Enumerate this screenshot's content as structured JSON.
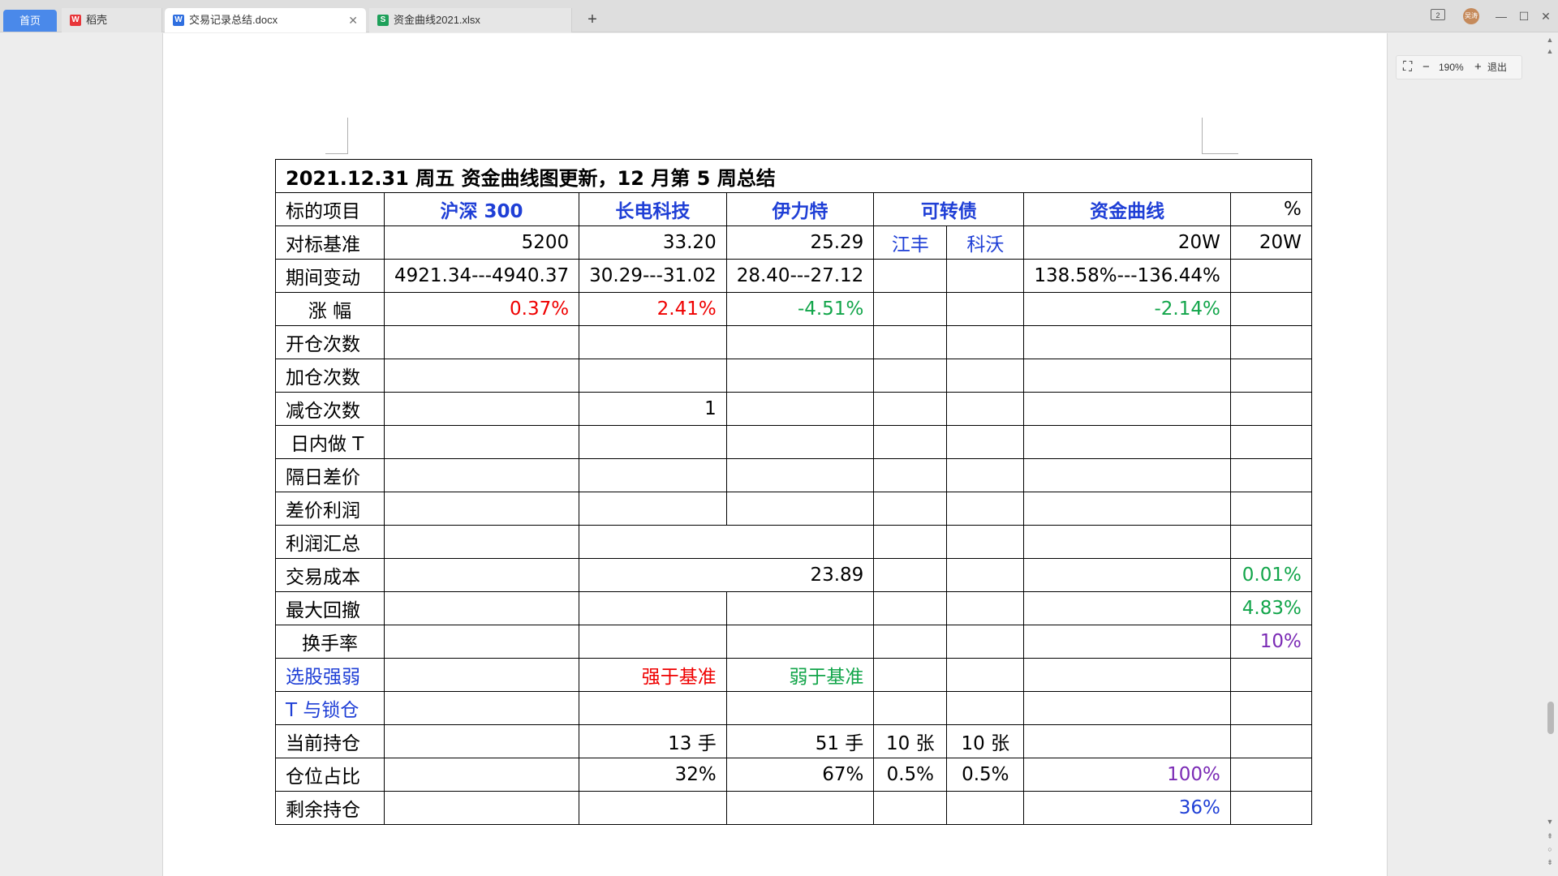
{
  "tabs": {
    "home": "首页",
    "wps": "稻壳",
    "doc": "交易记录总结.docx",
    "xlsx": "资金曲线2021.xlsx"
  },
  "window": {
    "avatar": "吴涛",
    "panel": "2"
  },
  "zoom": {
    "level": "190%",
    "exit": "退出"
  },
  "table": {
    "title": "2021.12.31  周五  资金曲线图更新，12 月第 5 周总结",
    "header": [
      "标的项目",
      "沪深 300",
      "长电科技",
      "伊力特",
      "可转债",
      "资金曲线",
      "%"
    ],
    "rows": {
      "benchmark": {
        "label": "对标基准",
        "hs300": "5200",
        "cd": "33.20",
        "ylt": "25.29",
        "jf": "江丰",
        "kw": "科沃",
        "zj": "20W",
        "pct": "20W"
      },
      "change": {
        "label": "期间变动",
        "hs300": "4921.34---4940.37",
        "cd": "30.29---31.02",
        "ylt": "28.40---27.12",
        "zj": "138.58%---136.44%"
      },
      "rise": {
        "label": "涨  幅",
        "hs300": "0.37%",
        "cd": "2.41%",
        "ylt": "-4.51%",
        "zj": "-2.14%"
      },
      "open": {
        "label": "开仓次数"
      },
      "add": {
        "label": "加仓次数"
      },
      "reduce": {
        "label": "减仓次数",
        "cd": "1"
      },
      "intraday": {
        "label": "日内做 T"
      },
      "overnight": {
        "label": "隔日差价"
      },
      "profit": {
        "label": "差价利润"
      },
      "total": {
        "label": "利润汇总"
      },
      "cost": {
        "label": "交易成本",
        "merged": "23.89",
        "pct": "0.01%"
      },
      "drawdown": {
        "label": "最大回撤",
        "pct": "4.83%"
      },
      "turnover": {
        "label": "换手率",
        "pct": "10%"
      },
      "pick": {
        "label": "选股强弱",
        "cd": "强于基准",
        "ylt": "弱于基准"
      },
      "tlock": {
        "label": "T 与锁仓"
      },
      "hold": {
        "label": "当前持仓",
        "cd": "13 手",
        "ylt": "51 手",
        "jf": "10 张",
        "kw": "10 张"
      },
      "ratio": {
        "label": "仓位占比",
        "cd": "32%",
        "ylt": "67%",
        "jf": "0.5%",
        "kw": "0.5%",
        "zj": "100%"
      },
      "remain": {
        "label": "剩余持仓",
        "zj": "36%"
      }
    }
  }
}
